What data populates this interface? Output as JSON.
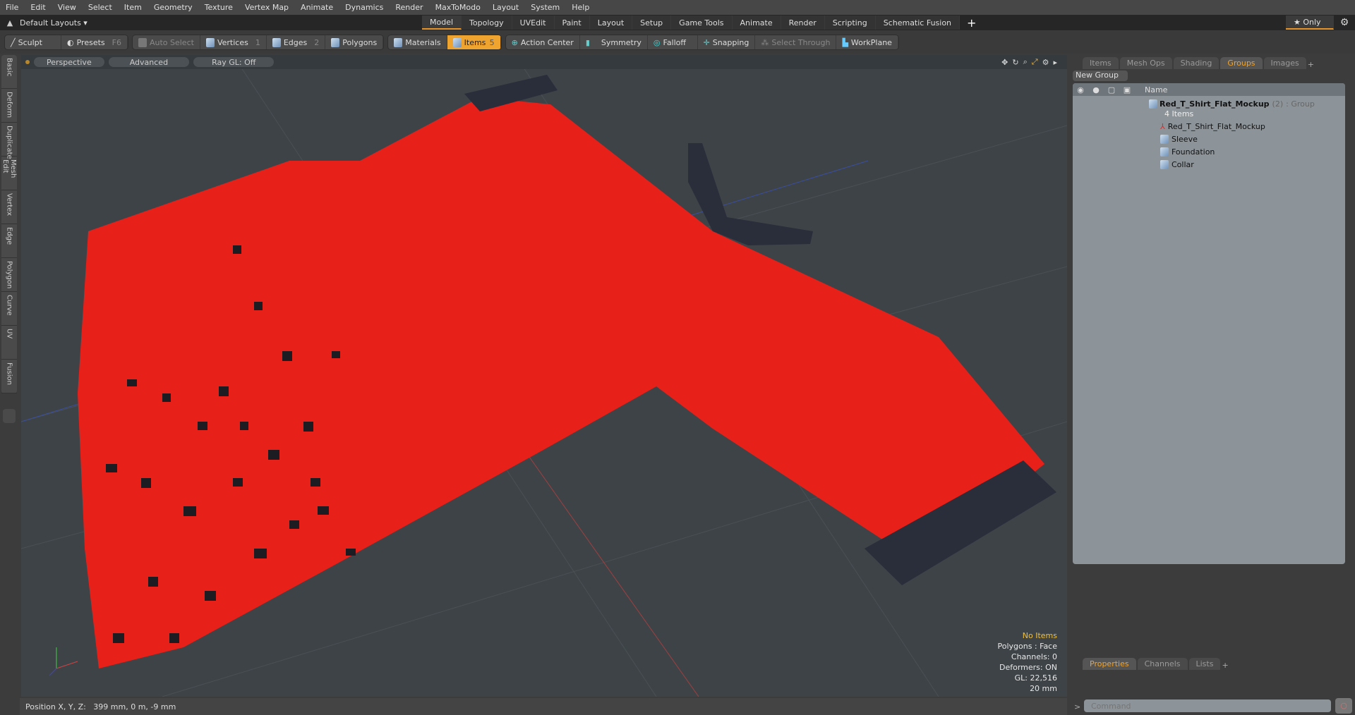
{
  "menu": [
    "File",
    "Edit",
    "View",
    "Select",
    "Item",
    "Geometry",
    "Texture",
    "Vertex Map",
    "Animate",
    "Dynamics",
    "Render",
    "MaxToModo",
    "Layout",
    "System",
    "Help"
  ],
  "layouts": {
    "label": "Default Layouts ▾",
    "tabs": [
      "Model",
      "Topology",
      "UVEdit",
      "Paint",
      "Layout",
      "Setup",
      "Game Tools",
      "Animate",
      "Render",
      "Scripting",
      "Schematic Fusion"
    ],
    "active": "Model",
    "add": "+",
    "only": "★ Only"
  },
  "toolbar": {
    "sculpt": "Sculpt",
    "presets": "Presets",
    "presets_key": "F6",
    "auto_select": "Auto Select",
    "vertices": "Vertices",
    "vertices_key": "1",
    "edges": "Edges",
    "edges_key": "2",
    "polygons": "Polygons",
    "materials": "Materials",
    "items": "Items",
    "items_key": "5",
    "action_center": "Action Center",
    "symmetry": "Symmetry",
    "falloff": "Falloff",
    "snapping": "Snapping",
    "select_through": "Select Through",
    "workplane": "WorkPlane"
  },
  "left_tabs": [
    "Basic",
    "Deform",
    "Duplicate",
    "Mesh Edit",
    "Vertex",
    "Edge",
    "Polygon",
    "Curve",
    "UV",
    "Fusion"
  ],
  "viewport": {
    "view": "Perspective",
    "shading": "Advanced",
    "raygl": "Ray GL: Off",
    "info": {
      "selection": "No Items",
      "polygons": "Polygons : Face",
      "channels": "Channels: 0",
      "deformers": "Deformers: ON",
      "gl": "GL: 22,516",
      "scale": "20 mm"
    }
  },
  "right_panel": {
    "tabs": [
      "Items",
      "Mesh Ops",
      "Shading",
      "Groups",
      "Images"
    ],
    "active": "Groups",
    "new_group": "New Group",
    "col_name": "Name",
    "group": {
      "name": "Red_T_Shirt_Flat_Mockup",
      "count": "(2)",
      "type": ": Group",
      "items_count": "4 Items"
    },
    "children": [
      "Red_T_Shirt_Flat_Mockup",
      "Sleeve",
      "Foundation",
      "Collar"
    ]
  },
  "bottom_panel": {
    "tabs": [
      "Properties",
      "Channels",
      "Lists"
    ],
    "active": "Properties",
    "command_placeholder": "Command"
  },
  "status": {
    "position": "Position X, Y, Z:   399 mm, 0 m, -9 mm"
  },
  "colors": {
    "accent": "#f0a430",
    "shirt": "#e8201a",
    "trim": "#2a2d3a"
  }
}
